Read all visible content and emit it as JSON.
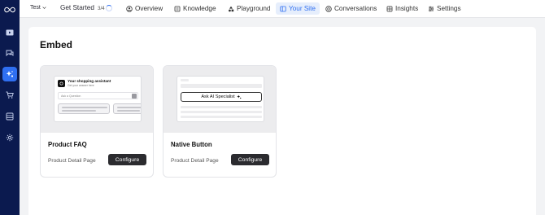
{
  "topbar": {
    "workspace": "Test",
    "get_started": "Get Started",
    "progress_text": "3/4",
    "tabs": [
      {
        "label": "Overview",
        "icon": "overview-icon"
      },
      {
        "label": "Knowledge",
        "icon": "knowledge-icon"
      },
      {
        "label": "Playground",
        "icon": "playground-icon"
      },
      {
        "label": "Your Site",
        "icon": "your-site-icon",
        "active": true
      },
      {
        "label": "Conversations",
        "icon": "conversations-icon"
      },
      {
        "label": "Insights",
        "icon": "insights-icon"
      },
      {
        "label": "Settings",
        "icon": "settings-icon"
      }
    ]
  },
  "sidebar": {
    "items": [
      {
        "icon": "logo-icon"
      },
      {
        "icon": "video-icon"
      },
      {
        "icon": "chat-icon"
      },
      {
        "icon": "sparkle-icon",
        "active": true
      },
      {
        "icon": "cart-icon"
      },
      {
        "icon": "database-icon"
      },
      {
        "icon": "gear-icon"
      }
    ]
  },
  "page": {
    "title": "Embed"
  },
  "cards": [
    {
      "title": "Product FAQ",
      "subtitle": "Product Detail Page",
      "button": "Configure",
      "preview": {
        "title": "Your shopping assistant",
        "subtitle": "Get your answer here",
        "placeholder": "Ask a Question"
      }
    },
    {
      "title": "Native Button",
      "subtitle": "Product Detail Page",
      "button": "Configure",
      "preview": {
        "button_label": "Ask AI Specialist"
      }
    }
  ],
  "colors": {
    "sidebar_bg": "#0b1a4f",
    "accent": "#2f6ff1",
    "button_dark": "#2b2b2f"
  }
}
